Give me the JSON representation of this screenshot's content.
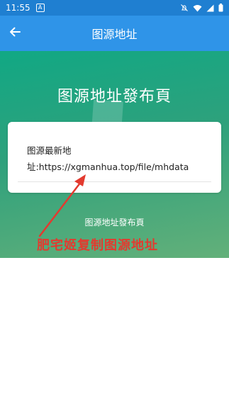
{
  "status_bar": {
    "time": "11:55",
    "app_badge": "A",
    "icons": [
      "notifications-off-icon",
      "wifi-icon",
      "signal-icon",
      "battery-icon"
    ]
  },
  "app_bar": {
    "back_icon": "arrow-left-icon",
    "title": "图源地址"
  },
  "hero": {
    "title": "图源地址發布頁",
    "card": {
      "label": "图源最新地",
      "address_text": "址:https://xgmanhua.top/file/mhdata"
    },
    "footer_text": "图源地址發布頁"
  },
  "annotation": {
    "text": "肥宅姬复制图源地址",
    "color": "#e33a2f"
  },
  "colors": {
    "status_bar": "#1f7fd1",
    "app_bar": "#2f94e8",
    "hero_gradient_start": "#11a884",
    "hero_gradient_end": "#63b07a"
  }
}
